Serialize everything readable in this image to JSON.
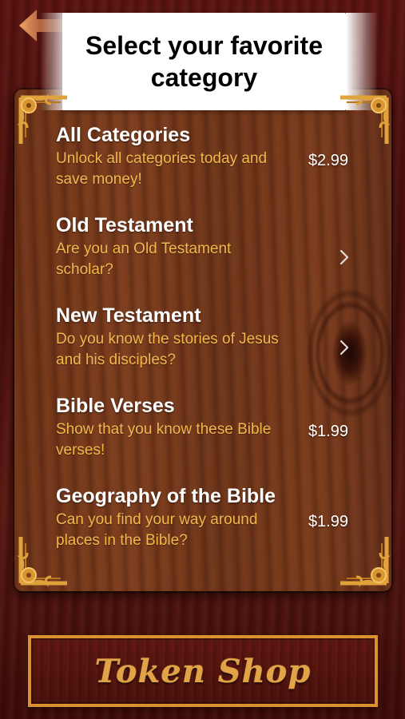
{
  "header": {
    "title": "Select your favorite category",
    "back_icon": "back-arrow-icon"
  },
  "categories": [
    {
      "title": "All Categories",
      "description": "Unlock all categories today and save money!",
      "price": "$2.99",
      "action": "price"
    },
    {
      "title": "Old Testament",
      "description": "Are you an Old Testament scholar?",
      "price": "",
      "action": "chevron"
    },
    {
      "title": "New Testament",
      "description": "Do you know the stories of Jesus and his disciples?",
      "price": "",
      "action": "chevron"
    },
    {
      "title": "Bible Verses",
      "description": "Show that you know these Bible verses!",
      "price": "$1.99",
      "action": "price"
    },
    {
      "title": "Geography of the Bible",
      "description": "Can you find your way around places in the Bible?",
      "price": "$1.99",
      "action": "price"
    }
  ],
  "footer": {
    "token_shop_label": "Token Shop"
  },
  "colors": {
    "accent_gold": "#f2b84d",
    "frame_gold": "#d9922f",
    "title_white": "#ffffff"
  }
}
